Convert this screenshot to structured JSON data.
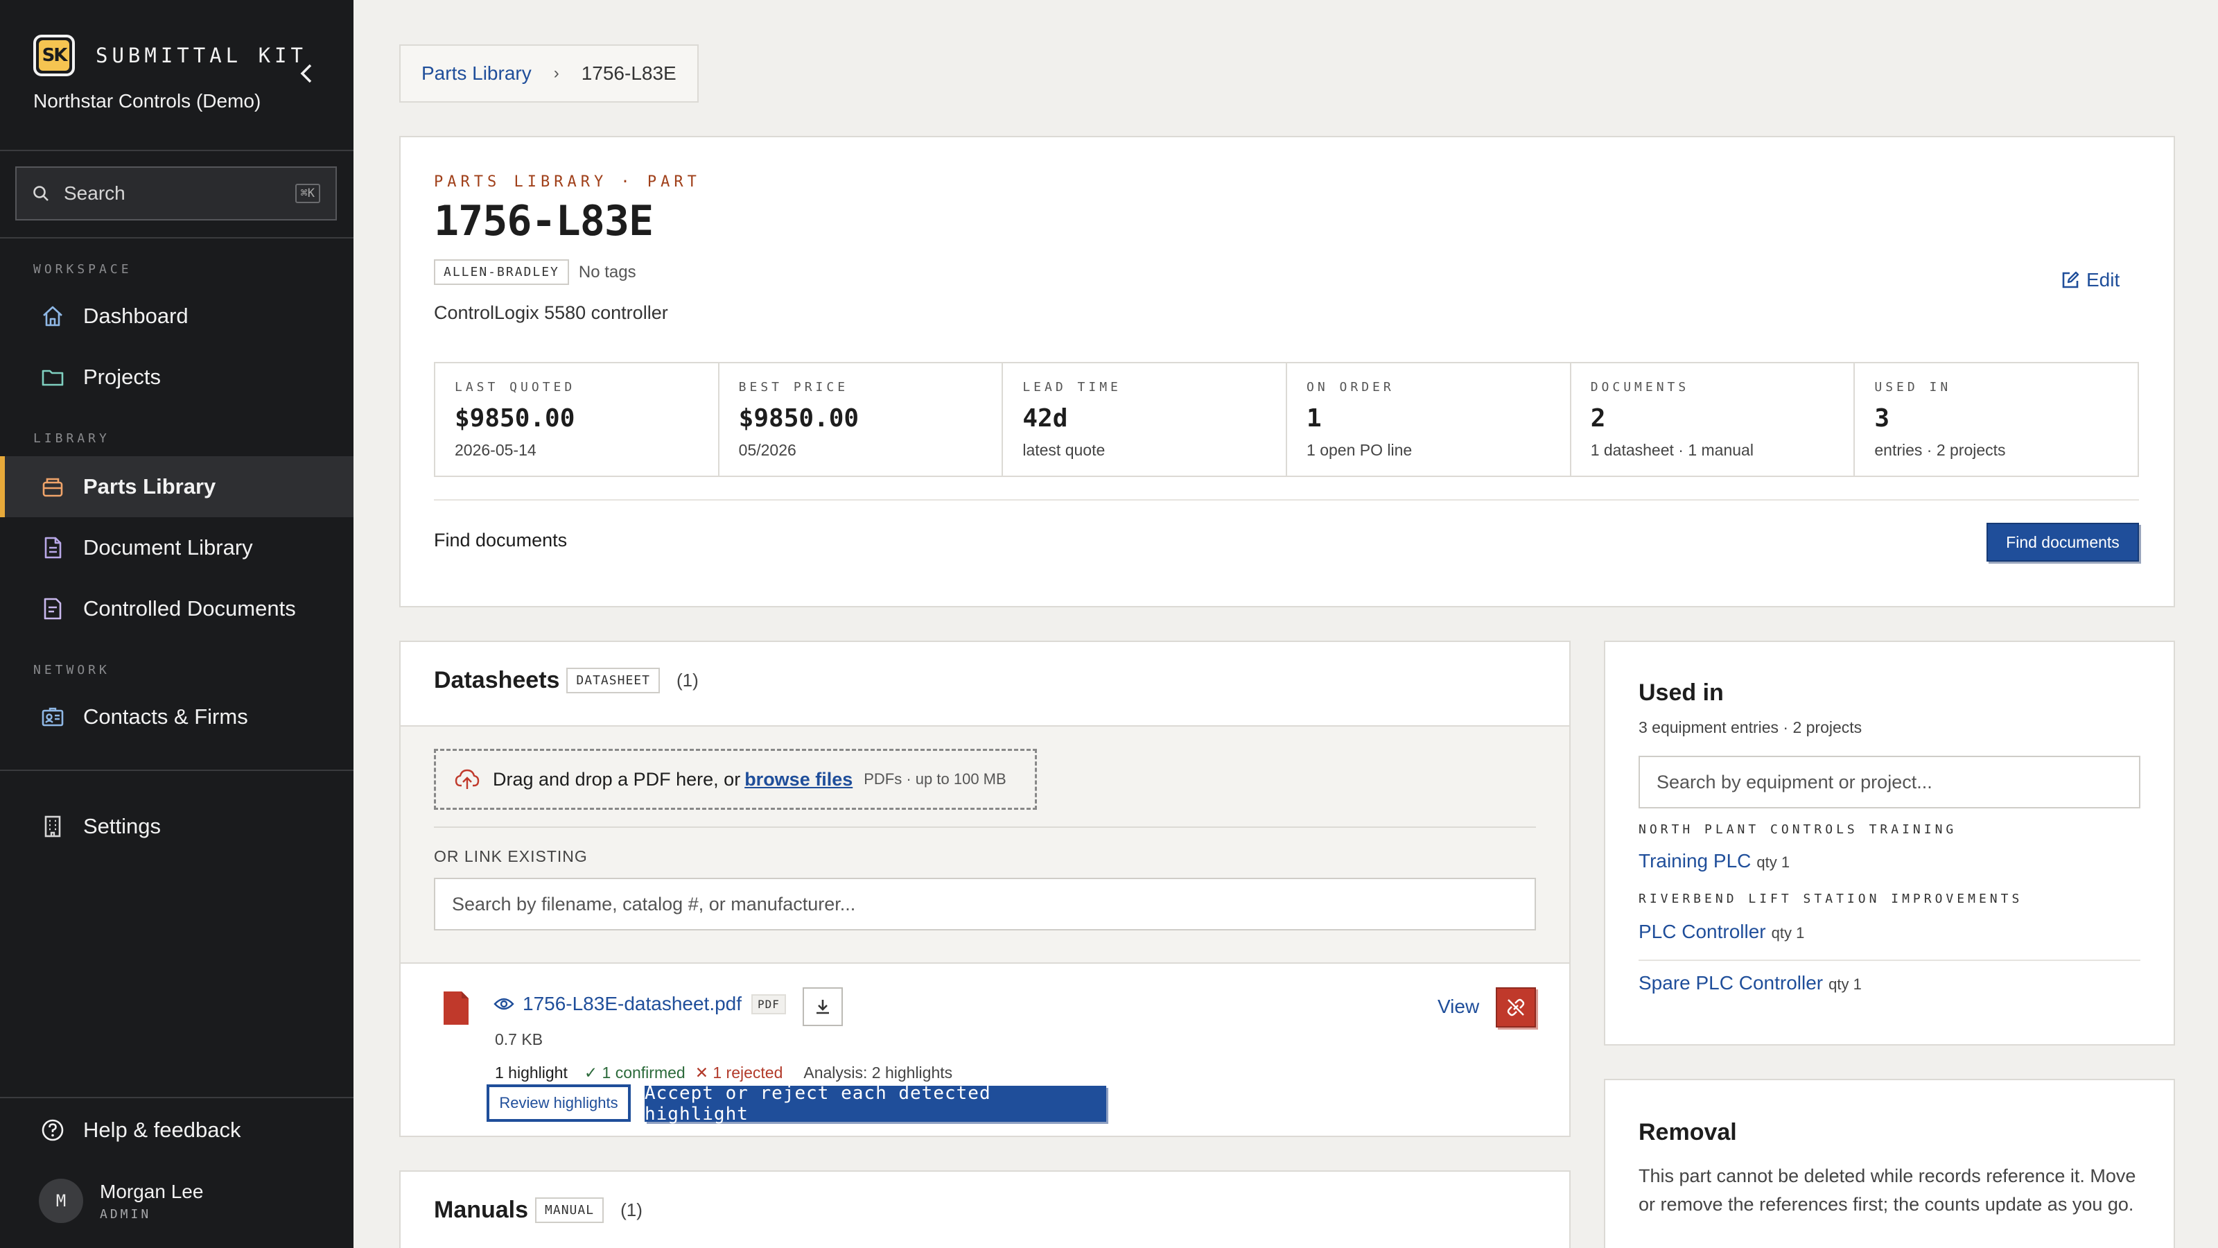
{
  "app": {
    "brand_logo": "SK",
    "brand_name": "SUBMITTAL KIT",
    "org_name": "Northstar Controls (Demo)"
  },
  "sidebar": {
    "search_label": "Search",
    "search_shortcut": "⌘K",
    "sections": {
      "workspace": "WORKSPACE",
      "library": "LIBRARY",
      "network": "NETWORK"
    },
    "items": [
      {
        "label": "Dashboard",
        "icon": "home-icon"
      },
      {
        "label": "Projects",
        "icon": "folder-icon"
      },
      {
        "label": "Parts Library",
        "icon": "parts-box-icon",
        "active": true
      },
      {
        "label": "Document Library",
        "icon": "document-icon"
      },
      {
        "label": "Controlled Documents",
        "icon": "controlled-document-icon"
      },
      {
        "label": "Contacts & Firms",
        "icon": "contact-card-icon"
      },
      {
        "label": "Settings",
        "icon": "building-icon"
      }
    ],
    "help_label": "Help & feedback",
    "user": {
      "initial": "M",
      "name": "Morgan Lee",
      "role": "ADMIN"
    }
  },
  "breadcrumb": {
    "parent": "Parts Library",
    "current": "1756-L83E"
  },
  "part": {
    "overline": "PARTS LIBRARY · PART",
    "title": "1756-L83E",
    "manufacturer": "ALLEN-BRADLEY",
    "tags_text": "No tags",
    "description": "ControlLogix 5580 controller",
    "edit_label": "Edit",
    "stats": [
      {
        "label": "LAST QUOTED",
        "value": "$9850.00",
        "sub": "2026-05-14"
      },
      {
        "label": "BEST PRICE",
        "value": "$9850.00",
        "sub": "05/2026"
      },
      {
        "label": "LEAD TIME",
        "value": "42d",
        "sub": "latest quote"
      },
      {
        "label": "ON ORDER",
        "value": "1",
        "sub": "1 open PO line"
      },
      {
        "label": "DOCUMENTS",
        "value": "2",
        "sub": "1 datasheet · 1 manual"
      },
      {
        "label": "USED IN",
        "value": "3",
        "sub": "entries · 2 projects"
      }
    ],
    "find_docs_label": "Find documents",
    "find_docs_button": "Find documents"
  },
  "datasheets": {
    "title": "Datasheets",
    "tag": "DATASHEET",
    "count": "(1)",
    "dropzone_text": "Drag and drop a PDF here, or ",
    "dropzone_link": "browse files",
    "dropzone_hint": "PDFs · up to 100 MB",
    "link_existing_label": "OR LINK EXISTING",
    "link_search_placeholder": "Search by filename, catalog #, or manufacturer...",
    "file": {
      "name": "1756-L83E-datasheet.pdf",
      "type": "PDF",
      "size": "0.7 KB",
      "view_label": "View",
      "highlights": "1 highlight",
      "confirmed": "✓ 1 confirmed",
      "rejected": "✕ 1 rejected",
      "analysis": "Analysis: 2 highlights",
      "review_label": "Review highlights",
      "tooltip": "Accept or reject each detected highlight"
    }
  },
  "manuals": {
    "title": "Manuals",
    "tag": "MANUAL",
    "count": "(1)"
  },
  "used_in": {
    "title": "Used in",
    "subtitle": "3 equipment entries · 2 projects",
    "search_placeholder": "Search by equipment or project...",
    "groups": [
      {
        "project": "NORTH PLANT CONTROLS TRAINING",
        "entries": [
          {
            "name": "Training PLC",
            "qty": "qty 1"
          }
        ]
      },
      {
        "project": "RIVERBEND LIFT STATION IMPROVEMENTS",
        "entries": [
          {
            "name": "PLC Controller",
            "qty": "qty 1"
          },
          {
            "name": "Spare PLC Controller",
            "qty": "qty 1"
          }
        ]
      }
    ]
  },
  "removal": {
    "title": "Removal",
    "text": "This part cannot be deleted while records reference it. Move or remove the references first; the counts update as you go."
  },
  "colors": {
    "sidebar_bg": "#1a1b1d",
    "accent_blue": "#1f4e9a",
    "active_marker": "#e7a93a",
    "overline_red": "#a0401a",
    "danger": "#c0392b"
  }
}
